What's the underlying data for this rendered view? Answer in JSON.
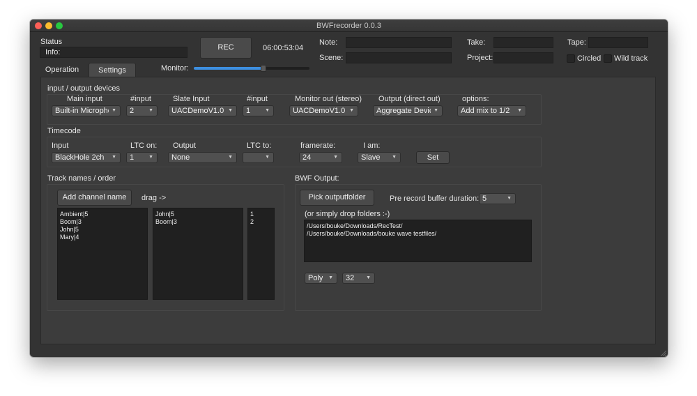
{
  "window": {
    "title": "BWFrecorder 0.0.3"
  },
  "header": {
    "status_label": "Status",
    "info_label": "Info:",
    "rec_button": "REC",
    "timecode": "06:00:53:04",
    "note_label": "Note:",
    "scene_label": "Scene:",
    "take_label": "Take:",
    "project_label": "Project:",
    "tape_label": "Tape:",
    "circled_label": "Circled",
    "wild_track_label": "Wild track",
    "monitor_label": "Monitor:",
    "monitor_level": 0.6
  },
  "tabs": [
    {
      "label": "Operation"
    },
    {
      "label": "Settings"
    }
  ],
  "io_devices": {
    "section_title": "input / output devices",
    "main_input_label": "Main input",
    "main_input_value": "Built-in Micropho",
    "main_input_num_label": "#input",
    "main_input_num_value": "2",
    "slate_input_label": "Slate Input",
    "slate_input_value": "UACDemoV1.0",
    "slate_num_label": "#input",
    "slate_num_value": "1",
    "monitor_out_label": "Monitor out (stereo)",
    "monitor_out_value": "UACDemoV1.0",
    "output_direct_label": "Output (direct out)",
    "output_direct_value": "Aggregate Device",
    "options_label": "options:",
    "options_value": "Add mix to 1/2"
  },
  "timecode": {
    "section_title": "Timecode",
    "input_label": "Input",
    "input_value": "BlackHole 2ch",
    "ltc_on_label": "LTC on:",
    "ltc_on_value": "1",
    "output_label": "Output",
    "output_value": "None",
    "ltc_to_label": "LTC to:",
    "ltc_to_value": "",
    "framerate_label": "framerate:",
    "framerate_value": "24",
    "i_am_label": "I am:",
    "i_am_value": "Slave",
    "set_button": "Set"
  },
  "tracks": {
    "section_title": "Track names / order",
    "add_channel_button": "Add channel name",
    "drag_label": "drag ->",
    "source_list": [
      "Ambient|5",
      "Boom|3",
      "John|5",
      "Mary|4"
    ],
    "order_list": [
      "John|5",
      "Boom|3"
    ],
    "index_list": [
      "1",
      "2"
    ]
  },
  "bwf": {
    "section_title": "BWF Output:",
    "pick_folder_button": "Pick outputfolder",
    "pre_record_label": "Pre record buffer duration:",
    "pre_record_value": "5",
    "drop_hint": "(or simply drop folders :-)",
    "folders": [
      "/Users/bouke/Downloads/RecTest/",
      "/Users/bouke/Downloads/bouke wave testfiles/"
    ],
    "format_value": "Poly",
    "bitdepth_value": "32"
  },
  "colors": {
    "window_bg": "#333333",
    "panel_bg": "#3c3c3c",
    "accent": "#3d8fe0",
    "close": "#fc5f57",
    "minimize": "#fdbc2e",
    "zoom": "#28c840"
  }
}
